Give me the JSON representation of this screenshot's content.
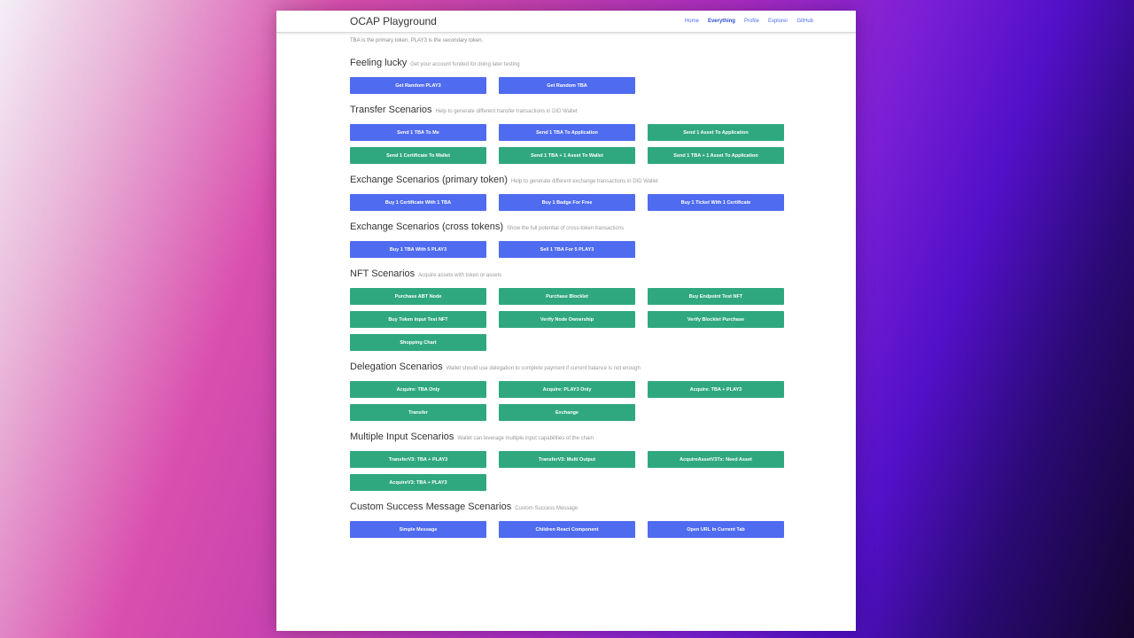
{
  "header": {
    "brand": "OCAP Playground",
    "nav": [
      {
        "label": "Home",
        "active": false
      },
      {
        "label": "Everything",
        "active": true
      },
      {
        "label": "Profile",
        "active": false
      },
      {
        "label": "Explorer",
        "active": false
      },
      {
        "label": "GitHub",
        "active": false
      }
    ]
  },
  "note": "TBA is the primary token, PLAY3 is the secondary token.",
  "colors": {
    "blue": "#4f6bf0",
    "green": "#30a87f"
  },
  "sections": [
    {
      "title": "Feeling lucky",
      "subtitle": "Get your account funded for doing later testing",
      "buttons": [
        {
          "label": "Get Random PLAY3",
          "color": "blue"
        },
        {
          "label": "Get Random TBA",
          "color": "blue"
        }
      ]
    },
    {
      "title": "Transfer Scenarios",
      "subtitle": "Help to generate different transfer transactions in DID Wallet",
      "buttons": [
        {
          "label": "Send 1 TBA To Me",
          "color": "blue"
        },
        {
          "label": "Send 1 TBA To Application",
          "color": "blue"
        },
        {
          "label": "Send 1 Asset To Application",
          "color": "green"
        },
        {
          "label": "Send 1 Certificate To Wallet",
          "color": "green"
        },
        {
          "label": "Send 1 TBA + 1 Asset To Wallet",
          "color": "green"
        },
        {
          "label": "Send 1 TBA + 1 Asset To Application",
          "color": "green"
        }
      ]
    },
    {
      "title": "Exchange Scenarios (primary token)",
      "subtitle": "Help to generate different exchange transactions in DID Wallet",
      "buttons": [
        {
          "label": "Buy 1 Certificate With 1 TBA",
          "color": "blue"
        },
        {
          "label": "Buy 1 Badge For Free",
          "color": "blue"
        },
        {
          "label": "Buy 1 Ticket With 1 Certificate",
          "color": "blue"
        }
      ]
    },
    {
      "title": "Exchange Scenarios (cross tokens)",
      "subtitle": "Show the full potential of cross-token transactions",
      "buttons": [
        {
          "label": "Buy 1 TBA With 5 PLAY3",
          "color": "blue"
        },
        {
          "label": "Sell 1 TBA For 5 PLAY3",
          "color": "blue"
        }
      ]
    },
    {
      "title": "NFT Scenarios",
      "subtitle": "Acquire assets with token or assets",
      "buttons": [
        {
          "label": "Purchase ABT Node",
          "color": "green"
        },
        {
          "label": "Purchase Blocklet",
          "color": "green"
        },
        {
          "label": "Buy Endpoint Test NFT",
          "color": "green"
        },
        {
          "label": "Buy Token Input Test NFT",
          "color": "green"
        },
        {
          "label": "Verify Node Ownership",
          "color": "green"
        },
        {
          "label": "Verify Blocklet Purchase",
          "color": "green"
        },
        {
          "label": "Shopping Chart",
          "color": "green"
        }
      ]
    },
    {
      "title": "Delegation Scenarios",
      "subtitle": "Wallet should use delegation to complete payment if current balance is not enough",
      "buttons": [
        {
          "label": "Acquire: TBA Only",
          "color": "green"
        },
        {
          "label": "Acquire: PLAY3 Only",
          "color": "green"
        },
        {
          "label": "Acquire: TBA + PLAY3",
          "color": "green"
        },
        {
          "label": "Transfer",
          "color": "green"
        },
        {
          "label": "Exchange",
          "color": "green"
        }
      ]
    },
    {
      "title": "Multiple Input Scenarios",
      "subtitle": "Wallet can leverage multiple input capabilities of the chain",
      "buttons": [
        {
          "label": "TransferV3: TBA + PLAY3",
          "color": "green"
        },
        {
          "label": "TransferV3: Multi Output",
          "color": "green"
        },
        {
          "label": "AcquireAssetV3Tx: Need Asset",
          "color": "green"
        },
        {
          "label": "AcquireV3: TBA + PLAY3",
          "color": "green"
        }
      ]
    },
    {
      "title": "Custom Success Message Scenarios",
      "subtitle": "Custom Success Message",
      "buttons": [
        {
          "label": "Simple Message",
          "color": "blue"
        },
        {
          "label": "Children React Component",
          "color": "blue"
        },
        {
          "label": "Open URL In Current Tab",
          "color": "blue"
        }
      ]
    }
  ]
}
